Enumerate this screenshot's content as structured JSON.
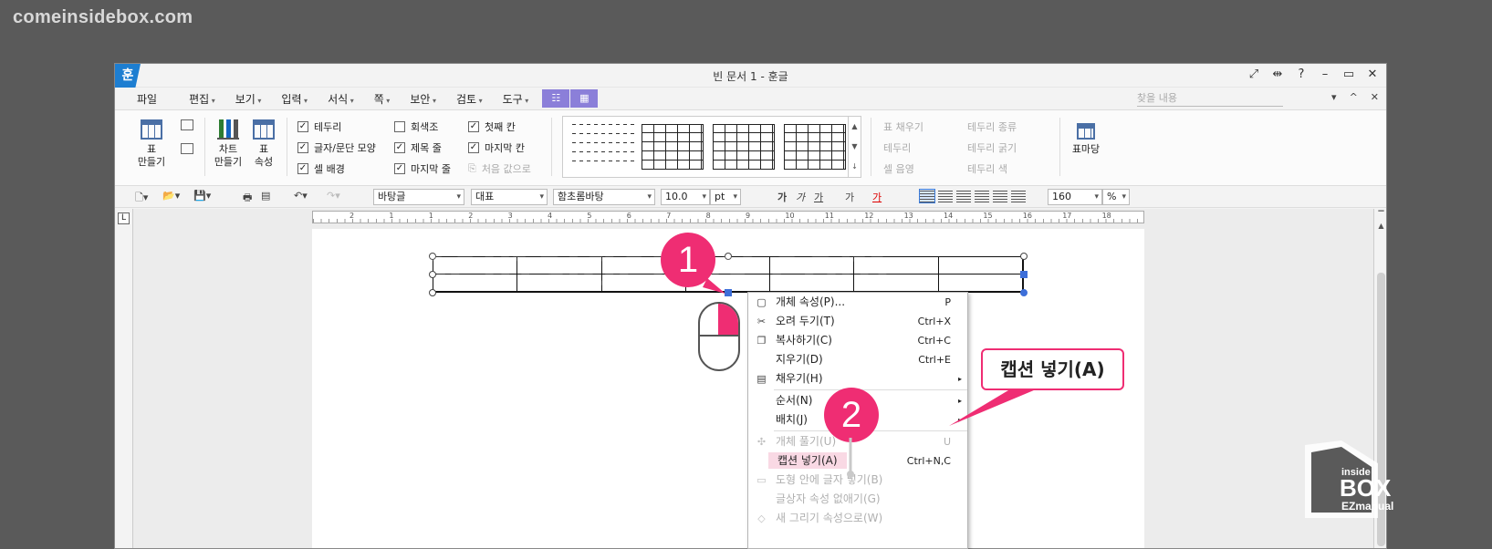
{
  "site_logo": "comeinsidebox.com",
  "window": {
    "app_icon": "훈",
    "title": "빈 문서 1 - 훈글",
    "controls": [
      "⤢",
      "⇹",
      "?",
      "–",
      "▭",
      "✕"
    ]
  },
  "menubar": {
    "file": "파일",
    "items": [
      "편집",
      "보기",
      "입력",
      "서식",
      "쪽",
      "보안",
      "검토",
      "도구"
    ],
    "search_placeholder": "찾을 내용",
    "right": [
      "▾",
      "^",
      "✕"
    ]
  },
  "ribbon": {
    "table_btn": "표\n만들기",
    "table_btn_l1": "표",
    "table_btn_l2": "만들기",
    "chart_l1": "차트",
    "chart_l2": "만들기",
    "props_l1": "표",
    "props_l2": "속성",
    "checks": [
      {
        "label": "테두리",
        "checked": true
      },
      {
        "label": "글자/문단 모양",
        "checked": true
      },
      {
        "label": "셀 배경",
        "checked": true
      },
      {
        "label": "회색조",
        "checked": false
      },
      {
        "label": "제목 줄",
        "checked": true
      },
      {
        "label": "마지막 줄",
        "checked": true
      },
      {
        "label": "첫째 칸",
        "checked": true
      },
      {
        "label": "마지막 칸",
        "checked": true
      },
      {
        "label": "처음 값으로",
        "checked": false
      }
    ],
    "cell_tools": [
      "표 채우기",
      "테두리",
      "셀 음영",
      "테두리 종류",
      "테두리 굵기",
      "테두리 색"
    ],
    "table_style": "표마당"
  },
  "fmtbar": {
    "style": "바탕글",
    "lang": "대표",
    "font": "함초롬바탕",
    "size": "10.0",
    "unit": "pt",
    "text_styles": [
      "가",
      "가",
      "가",
      "가",
      "가"
    ],
    "zoom": "160",
    "zoom_unit": "%"
  },
  "ruler_numbers": [
    "2",
    "1",
    "1",
    "2",
    "3",
    "4",
    "5",
    "6",
    "7",
    "8",
    "9",
    "10",
    "11",
    "12",
    "13",
    "14",
    "15",
    "16",
    "17",
    "18"
  ],
  "context_menu": {
    "items": [
      {
        "icon": "▢",
        "label": "개체 속성(P)...",
        "shortcut": "P",
        "disabled": false
      },
      {
        "icon": "✂",
        "label": "오려 두기(T)",
        "shortcut": "Ctrl+X",
        "disabled": false
      },
      {
        "icon": "❐",
        "label": "복사하기(C)",
        "shortcut": "Ctrl+C",
        "disabled": false
      },
      {
        "icon": "",
        "label": "지우기(D)",
        "shortcut": "Ctrl+E",
        "disabled": false
      },
      {
        "icon": "▤",
        "label": "채우기(H)",
        "shortcut": "",
        "submenu": true,
        "disabled": false
      },
      {
        "icon": "",
        "label": "순서(N)",
        "shortcut": "",
        "submenu": true,
        "disabled": false
      },
      {
        "icon": "",
        "label": "배치(J)",
        "shortcut": "",
        "submenu": true,
        "disabled": false
      },
      {
        "icon": "✣",
        "label": "개체 풀기(U)",
        "shortcut": "U",
        "disabled": true
      },
      {
        "icon": "",
        "label": "캡션 넣기(A)",
        "shortcut": "Ctrl+N,C",
        "disabled": false,
        "highlight": true
      },
      {
        "icon": "▭",
        "label": "도형 안에 글자 넣기(B)",
        "shortcut": "",
        "disabled": true
      },
      {
        "icon": "",
        "label": "글상자 속성 없애기(G)",
        "shortcut": "",
        "disabled": true
      },
      {
        "icon": "◇",
        "label": "새 그리기 속성으로(W)",
        "shortcut": "",
        "disabled": true
      }
    ]
  },
  "annotations": {
    "step1": "1",
    "step2": "2",
    "callout": "캡션 넣기(A)"
  },
  "brand": {
    "top": "inside",
    "middle": "BOX",
    "bottom": "EZmanual"
  },
  "colors": {
    "accent_pink": "#ef2d73",
    "app_blue": "#1d7ed1",
    "handle_blue": "#3d6fd9"
  }
}
